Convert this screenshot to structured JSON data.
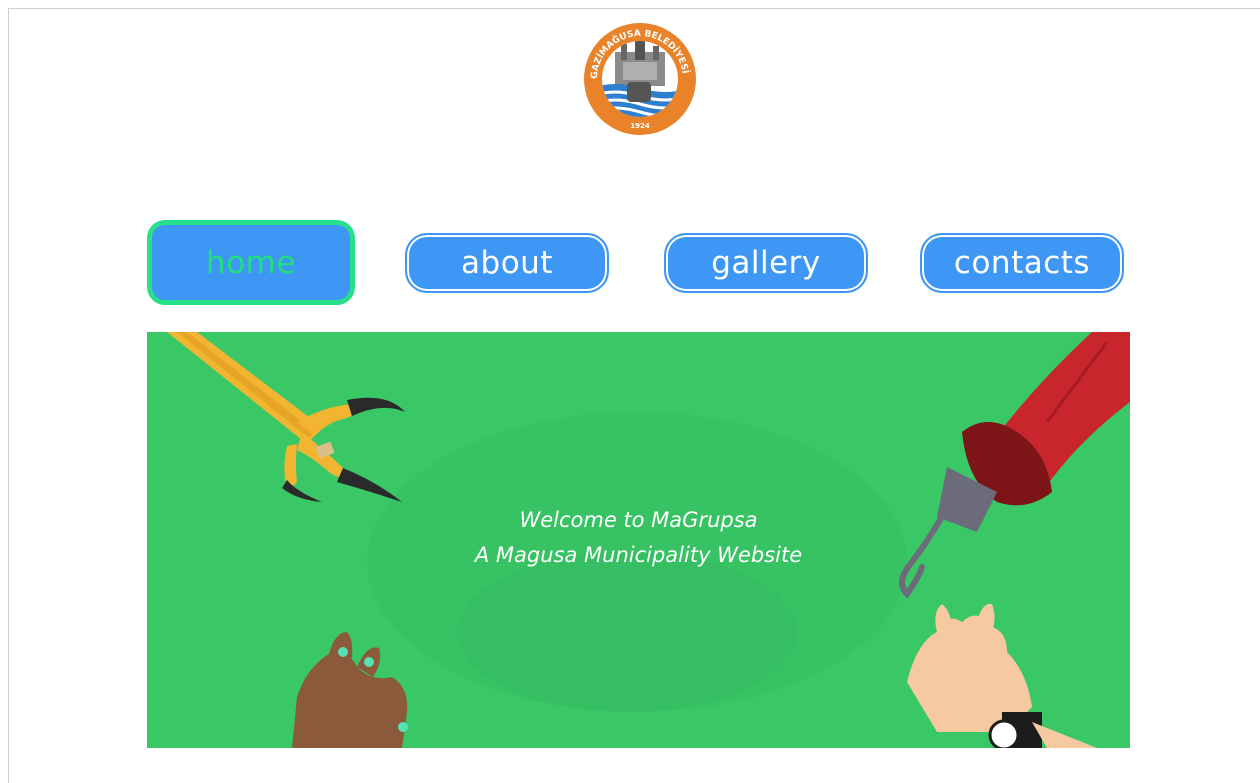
{
  "logo": {
    "ring_text": "GAZİMAĞUSA BELEDİYESİ",
    "year": "1924"
  },
  "nav": {
    "items": [
      {
        "label": "home",
        "active": true
      },
      {
        "label": "about",
        "active": false
      },
      {
        "label": "gallery",
        "active": false
      },
      {
        "label": "contacts",
        "active": false
      }
    ]
  },
  "hero": {
    "line1": "Welcome to MaGrupsa",
    "line2": "A Magusa Municipality Website"
  },
  "colors": {
    "button_blue": "#3f97f5",
    "active_green": "#29e08a",
    "hero_green": "#3ac867"
  }
}
